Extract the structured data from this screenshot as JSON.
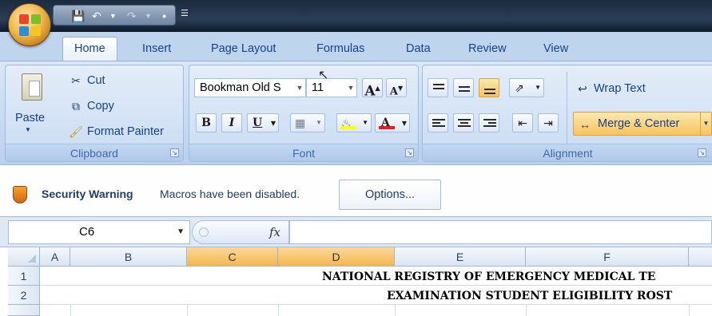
{
  "tabs": [
    "Home",
    "Insert",
    "Page Layout",
    "Formulas",
    "Data",
    "Review",
    "View"
  ],
  "clipboard": {
    "label": "Clipboard",
    "paste": "Paste",
    "cut": "Cut",
    "copy": "Copy",
    "format_painter": "Format Painter"
  },
  "font": {
    "label": "Font",
    "name": "Bookman Old S",
    "size": "11",
    "bold": "B",
    "italic": "I",
    "underline": "U",
    "grow": "A",
    "shrink": "A",
    "color_glyph": "A"
  },
  "alignment": {
    "label": "Alignment",
    "wrap_text": "Wrap Text",
    "merge_center": "Merge & Center"
  },
  "security": {
    "title": "Security Warning",
    "message": "Macros have been disabled.",
    "options": "Options..."
  },
  "formula_bar": {
    "name_box": "C6",
    "fx": "fx"
  },
  "grid": {
    "columns": [
      "A",
      "B",
      "C",
      "D",
      "E",
      "F"
    ],
    "rows": [
      "1",
      "2"
    ],
    "row1_text": "NATIONAL REGISTRY OF EMERGENCY MEDICAL TE",
    "row2_text": "EXAMINATION STUDENT ELIGIBILITY ROST"
  },
  "colors": {
    "accent": "#15428b",
    "selected_header": "#f5b64c",
    "ribbon": "#c7daf2"
  }
}
